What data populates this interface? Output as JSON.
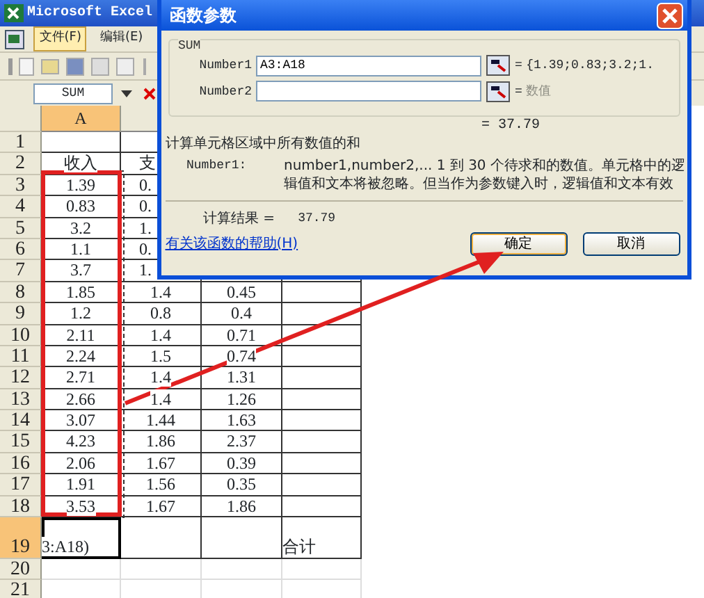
{
  "app": {
    "title": "Microsoft Excel"
  },
  "menu": [
    {
      "label": "文件(F)",
      "selected": true
    },
    {
      "label": "编辑(E)",
      "selected": false
    }
  ],
  "name_box": "SUM",
  "columns": [
    {
      "label": "A",
      "selected": true
    }
  ],
  "rows": [
    {
      "number": "1",
      "selected": false
    },
    {
      "number": "2",
      "selected": false,
      "a": "收入",
      "b": "支"
    },
    {
      "number": "3",
      "selected": false,
      "a": "1.39",
      "b": "0."
    },
    {
      "number": "4",
      "selected": false,
      "a": "0.83",
      "b": "0."
    },
    {
      "number": "5",
      "selected": false,
      "a": "3.2",
      "b": "1."
    },
    {
      "number": "6",
      "selected": false,
      "a": "1.1",
      "b": "0."
    },
    {
      "number": "7",
      "selected": false,
      "a": "3.7",
      "b": "1."
    },
    {
      "number": "8",
      "selected": false,
      "a": "1.85",
      "b": "1.4",
      "c": "0.45"
    },
    {
      "number": "9",
      "selected": false,
      "a": "1.2",
      "b": "0.8",
      "c": "0.4"
    },
    {
      "number": "10",
      "selected": false,
      "a": "2.11",
      "b": "1.4",
      "c": "0.71"
    },
    {
      "number": "11",
      "selected": false,
      "a": "2.24",
      "b": "1.5",
      "c": "0.74"
    },
    {
      "number": "12",
      "selected": false,
      "a": "2.71",
      "b": "1.4",
      "c": "1.31"
    },
    {
      "number": "13",
      "selected": false,
      "a": "2.66",
      "b": "1.4",
      "c": "1.26"
    },
    {
      "number": "14",
      "selected": false,
      "a": "3.07",
      "b": "1.44",
      "c": "1.63"
    },
    {
      "number": "15",
      "selected": false,
      "a": "4.23",
      "b": "1.86",
      "c": "2.37"
    },
    {
      "number": "16",
      "selected": false,
      "a": "2.06",
      "b": "1.67",
      "c": "0.39"
    },
    {
      "number": "17",
      "selected": false,
      "a": "1.91",
      "b": "1.56",
      "c": "0.35"
    },
    {
      "number": "18",
      "selected": false,
      "a": "3.53",
      "b": "1.67",
      "c": "1.86"
    },
    {
      "number": "19",
      "selected": true,
      "a": "3:A18)",
      "d": "合计"
    },
    {
      "number": "20",
      "selected": false
    },
    {
      "number": "21",
      "selected": false
    }
  ],
  "dialog": {
    "title": "函数参数",
    "group": "SUM",
    "args": [
      {
        "label": "Number1",
        "value": "A3:A18",
        "equals": "=",
        "result": "{1.39;0.83;3.2;1.",
        "muted": false
      },
      {
        "label": "Number2",
        "equals": "=",
        "result": "数值",
        "muted": true
      }
    ],
    "total": "= 37.79",
    "description": "计算单元格区域中所有数值的和",
    "arg_name": "Number1:",
    "arg_help": "number1,number2,... 1 到 30 个待求和的数值。单元格中的逻辑值和文本将被忽略。但当作为参数键入时，逻辑值和文本有效",
    "result_label": "计算结果 =",
    "result_value": "37.79",
    "help_link": "有关该函数的帮助(H)",
    "buttons": [
      {
        "label": "确定",
        "selected": true
      },
      {
        "label": "取消",
        "selected": false
      }
    ]
  }
}
